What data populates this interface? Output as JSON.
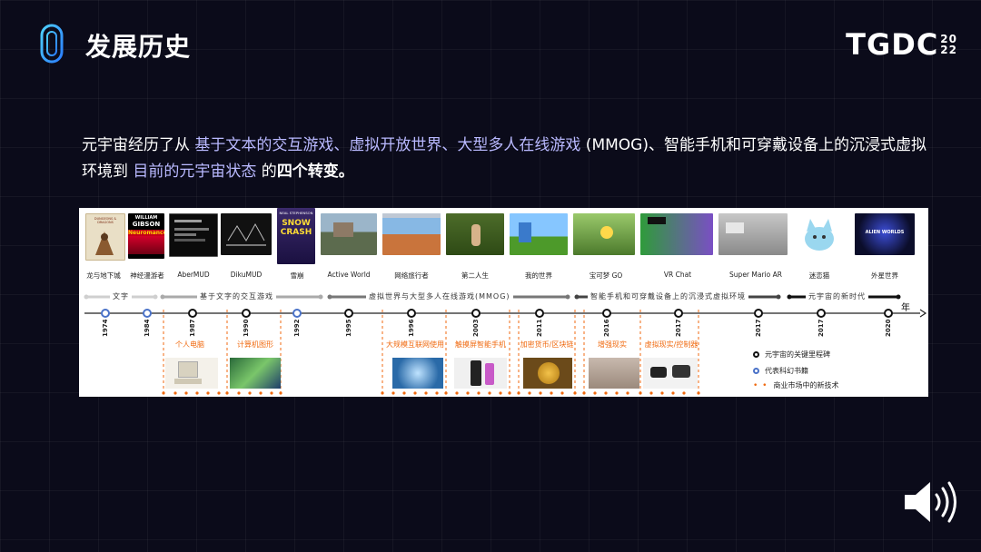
{
  "header": {
    "title": "发展历史",
    "brand": "TGDC",
    "brand_year_top": "20",
    "brand_year_bottom": "22"
  },
  "intro": {
    "p1": "元宇宙经历了从 ",
    "hl1": "基于文本的交互游戏、虚拟开放世界、大型多人在线游戏",
    "p2": " (MMOG)、智能手机和可穿戴设备上的沉浸式虚拟环境到 ",
    "hl2": "目前的元宇宙状态",
    "p3": " 的",
    "bold": "四个转变。"
  },
  "events": [
    {
      "label": "龙与地下城"
    },
    {
      "label": "神经漫游者"
    },
    {
      "label": "AberMUD"
    },
    {
      "label": "DikuMUD"
    },
    {
      "label": "雪崩"
    },
    {
      "label": "Active World"
    },
    {
      "label": "网络旅行者"
    },
    {
      "label": "第二人生"
    },
    {
      "label": "我的世界"
    },
    {
      "label": "宝可梦 GO"
    },
    {
      "label": "VR Chat"
    },
    {
      "label": "Super Mario AR"
    },
    {
      "label": "迷恋猫"
    },
    {
      "label": "外星世界"
    }
  ],
  "covers": {
    "dnd": "DUNGEONS & DRAGONS",
    "gibson_1": "WILLIAM",
    "gibson_2": "GIBSON",
    "gibson_3": "Neuromancer",
    "snow_1": "NEAL STEPHENSON",
    "snow_2": "SNOW",
    "snow_3": "CRASH",
    "alien": "ALIEN WORLDS"
  },
  "eras": [
    {
      "label": "文字"
    },
    {
      "label": "基于文字的交互游戏"
    },
    {
      "label": "虚拟世界与大型多人在线游戏(MMOG)"
    },
    {
      "label": "智能手机和可穿戴设备上的沉浸式虚拟环境"
    },
    {
      "label": "元宇宙的新时代"
    }
  ],
  "year_unit": "年",
  "years": [
    "1974",
    "1984",
    "1987",
    "1990",
    "1992",
    "1995",
    "1996",
    "2003",
    "2011",
    "2016",
    "2017",
    "2017",
    "2017",
    "2020"
  ],
  "techs": [
    {
      "label": "个人电脑"
    },
    {
      "label": "计算机图形"
    },
    {
      "label": "大规模互联网使用"
    },
    {
      "label": "触摸屏智能手机"
    },
    {
      "label": "加密货币/区块链"
    },
    {
      "label": "增强现实"
    },
    {
      "label": "虚拟现实/控制器"
    }
  ],
  "legend": [
    {
      "label": "元宇宙的关键里程碑"
    },
    {
      "label": "代表科幻书籍"
    },
    {
      "label": "商业市场中的新技术"
    }
  ],
  "colors": {
    "accent": "#f06a10",
    "scifi": "#4a72c8",
    "milestone": "#111111",
    "highlight": "#b9b9ff"
  }
}
